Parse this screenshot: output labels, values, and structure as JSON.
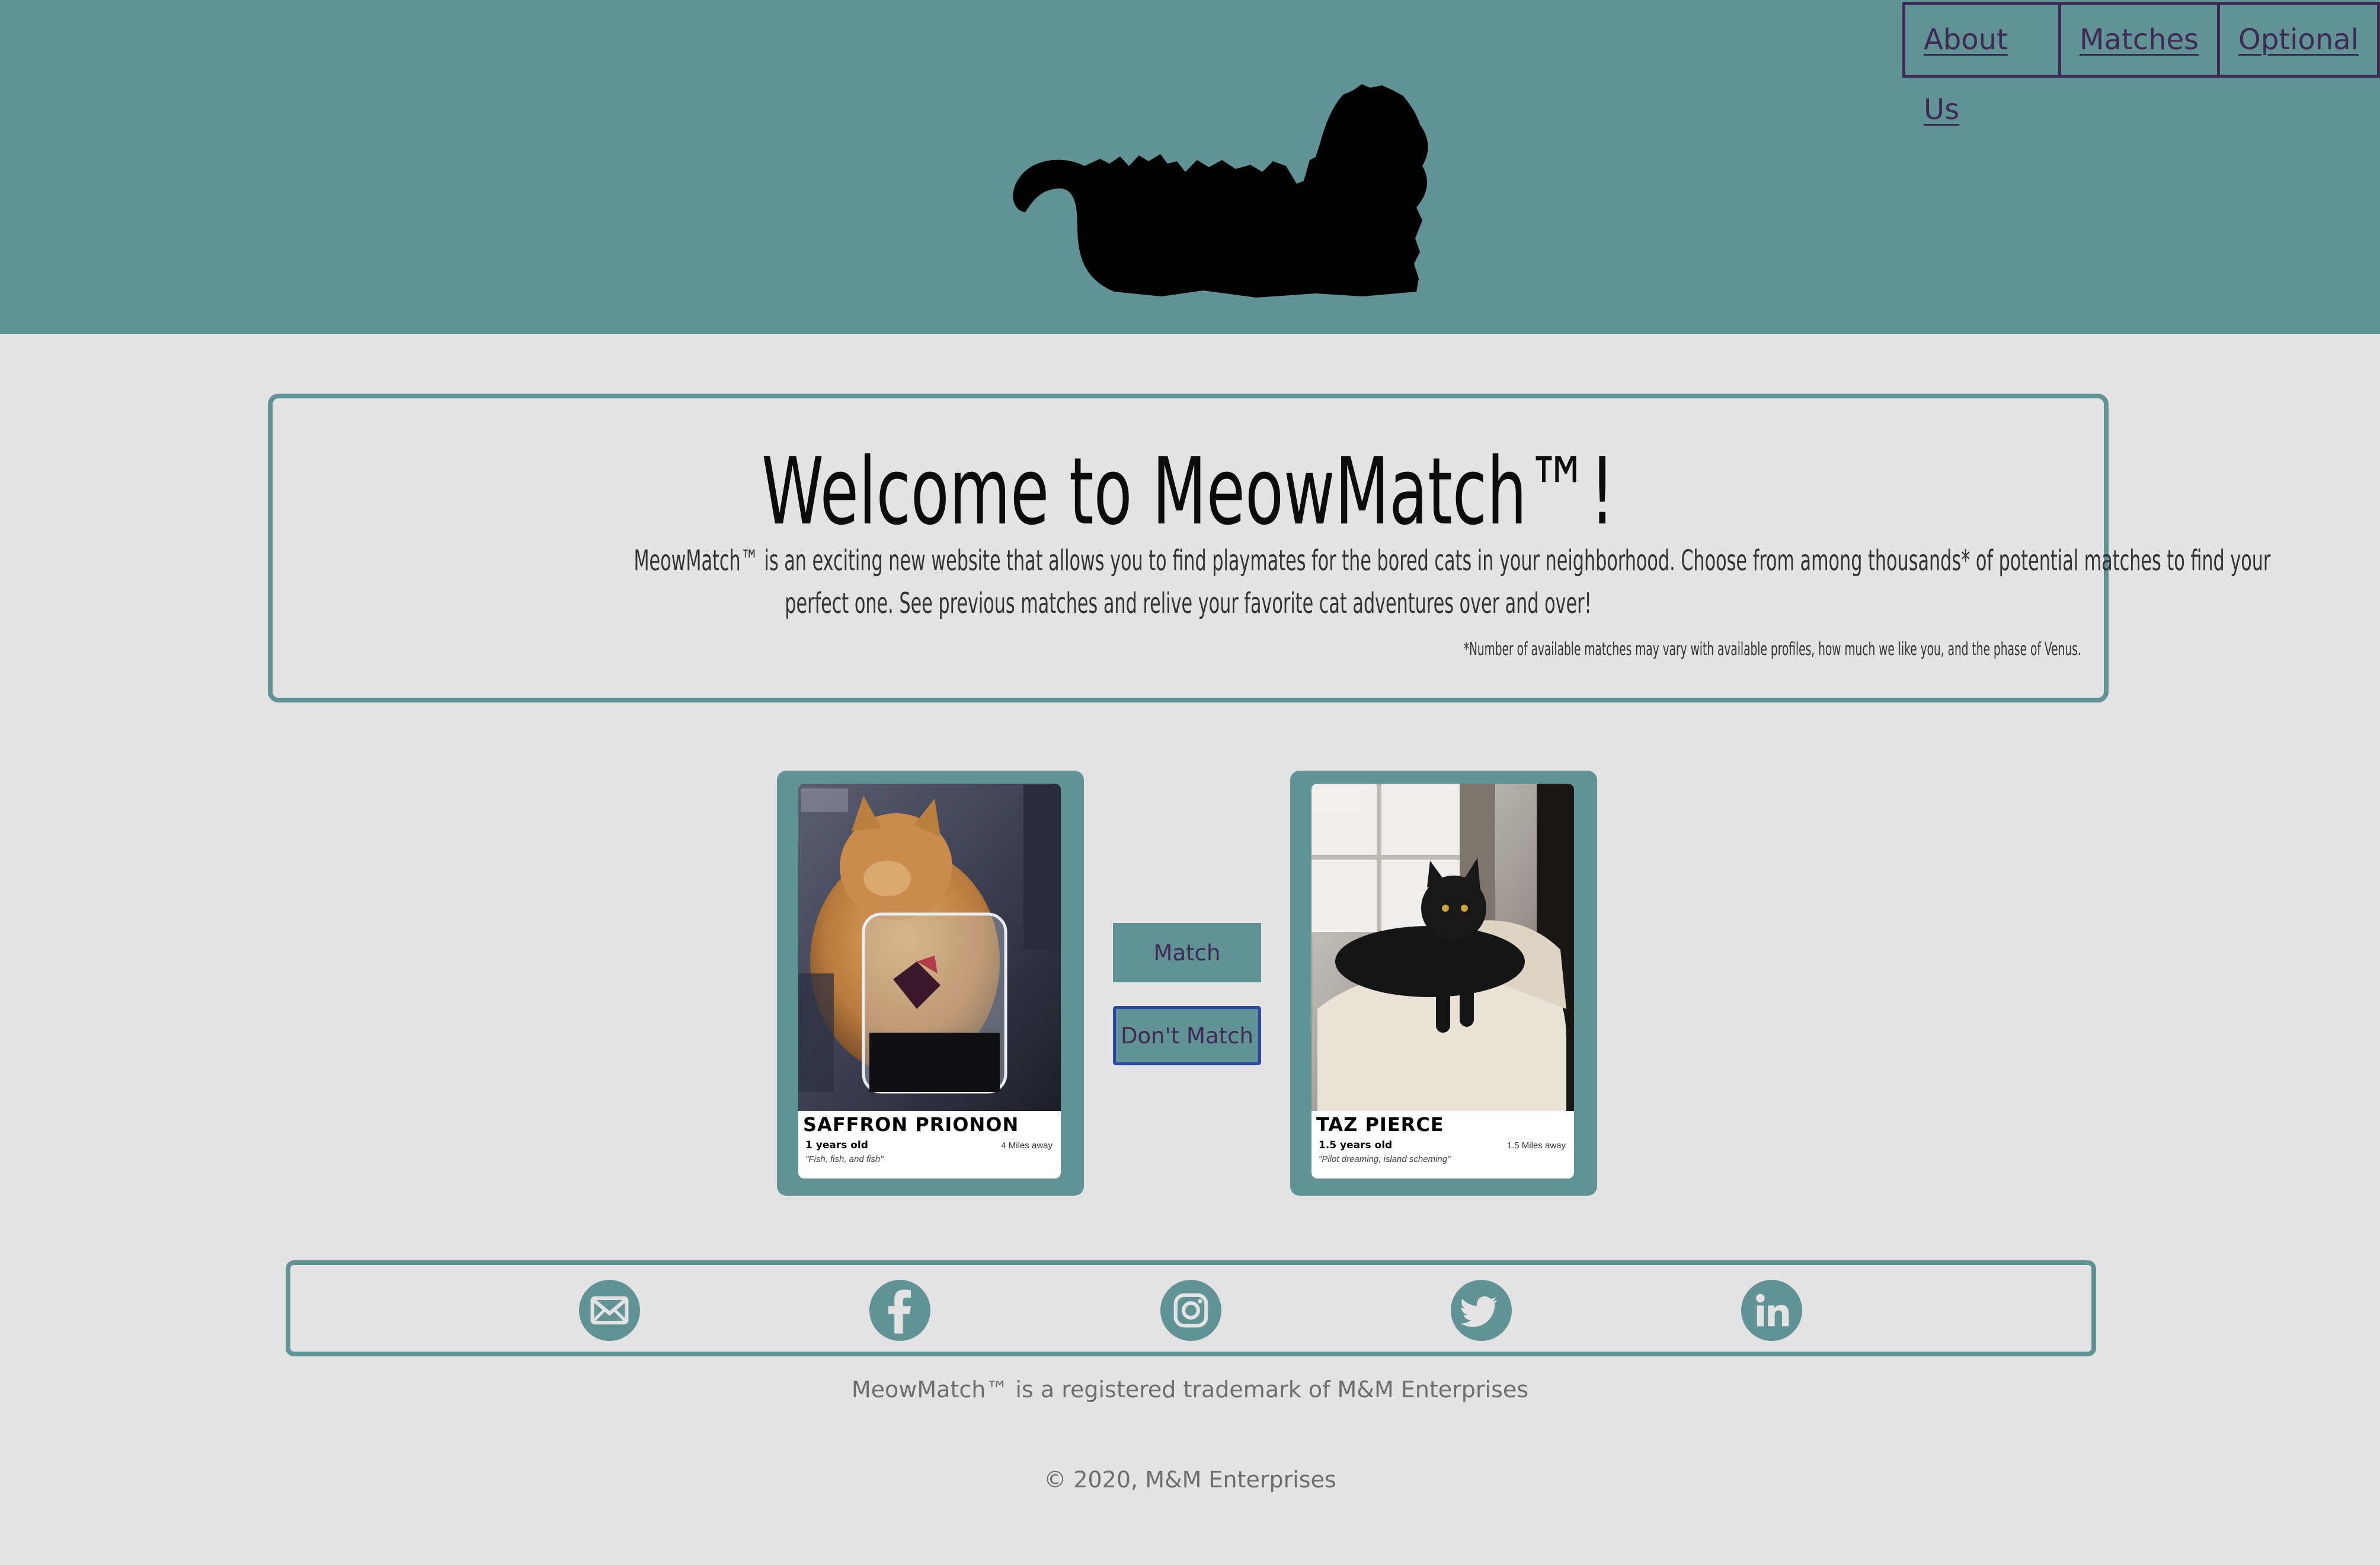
{
  "nav": {
    "items": [
      {
        "label": "About Us"
      },
      {
        "label": "Matches"
      },
      {
        "label": "Optional"
      }
    ]
  },
  "header": {
    "logo_icon": "cat-silhouette-logo-icon",
    "colors": {
      "header_bg": "#619395",
      "nav_border": "#3e2a55"
    }
  },
  "welcome": {
    "title": "Welcome to MeowMatch™!",
    "intro_line1": "MeowMatch™ is an exciting new website that allows you to find playmates for the bored cats in your neighborhood. Choose from among thousands* of potential matches to find your",
    "intro_line2": "perfect one. See previous matches and relive your favorite cat adventures over and over!",
    "fineprint": "*Number of available matches may vary with available profiles, how much we like you, and the phase of Venus."
  },
  "cards": [
    {
      "name": "SAFFRON PRIONON",
      "age": "1 years old",
      "distance": "4  Miles away",
      "quote": "\"Fish, fish, and fish\""
    },
    {
      "name": "TAZ PIERCE",
      "age": "1.5 years old",
      "distance": "1.5 Miles away",
      "quote": "\"Pilot dreaming, island scheming\""
    }
  ],
  "actions": {
    "match_label": "Match",
    "dont_match_label": "Don't Match"
  },
  "social": {
    "icons": [
      "email-icon",
      "facebook-icon",
      "instagram-icon",
      "twitter-icon",
      "linkedin-icon"
    ],
    "color": "#619395"
  },
  "footer": {
    "trademark": "MeowMatch™ is a registered trademark of M&M Enterprises",
    "copyright": "© 2020, M&M Enterprises"
  }
}
